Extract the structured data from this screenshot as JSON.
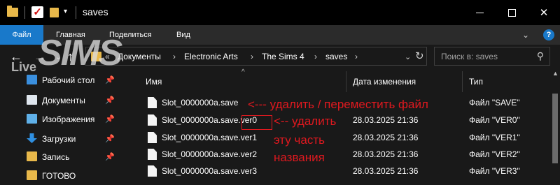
{
  "window": {
    "title": "saves",
    "minimize_icon": "minimize-icon",
    "maximize_icon": "maximize-icon",
    "close_label": "✕"
  },
  "ribbon": {
    "tabs": [
      "Файл",
      "Главная",
      "Поделиться",
      "Вид"
    ],
    "accent": "#1979ca",
    "help_label": "?"
  },
  "address": {
    "crumbs": [
      "Документы",
      "Electronic Arts",
      "The Sims 4",
      "saves"
    ],
    "search_placeholder": "Поиск в: saves"
  },
  "sidebar": {
    "items": [
      {
        "label": "Рабочий стол",
        "icon": "desktop-icon",
        "color": "#3a8fde",
        "pinned": true
      },
      {
        "label": "Документы",
        "icon": "documents-icon",
        "color": "#dfe6ee",
        "pinned": true
      },
      {
        "label": "Изображения",
        "icon": "pictures-icon",
        "color": "#5fb0e8",
        "pinned": true
      },
      {
        "label": "Загрузки",
        "icon": "downloads-icon",
        "color": "#2f8fe0",
        "pinned": true
      },
      {
        "label": "Запись",
        "icon": "folder-icon",
        "color": "#e8b84a",
        "pinned": true
      },
      {
        "label": "ГОТОВО",
        "icon": "folder-icon",
        "color": "#e8b84a",
        "pinned": false
      }
    ]
  },
  "columns": {
    "name": "Имя",
    "date": "Дата изменения",
    "type": "Тип"
  },
  "files": [
    {
      "name": "Slot_0000000a.save",
      "date": "",
      "type": "Файл \"SAVE\""
    },
    {
      "name": "Slot_0000000a.save.ver0",
      "date": "28.03.2025 21:36",
      "type": "Файл \"VER0\""
    },
    {
      "name": "Slot_0000000a.save.ver1",
      "date": "28.03.2025 21:36",
      "type": "Файл \"VER1\""
    },
    {
      "name": "Slot_0000000a.save.ver2",
      "date": "28.03.2025 21:36",
      "type": "Файл \"VER2\""
    },
    {
      "name": "Slot_0000000a.save.ver3",
      "date": "28.03.2025 21:36",
      "type": "Файл \"VER3\""
    }
  ],
  "annotations": {
    "line1": "<--- удалить / переместить файл",
    "line2": "<-- удалить",
    "line3": "эту часть",
    "line4": "названия",
    "color": "#e0191f"
  },
  "watermark": {
    "live": "Live",
    "sims": "SIMS"
  }
}
